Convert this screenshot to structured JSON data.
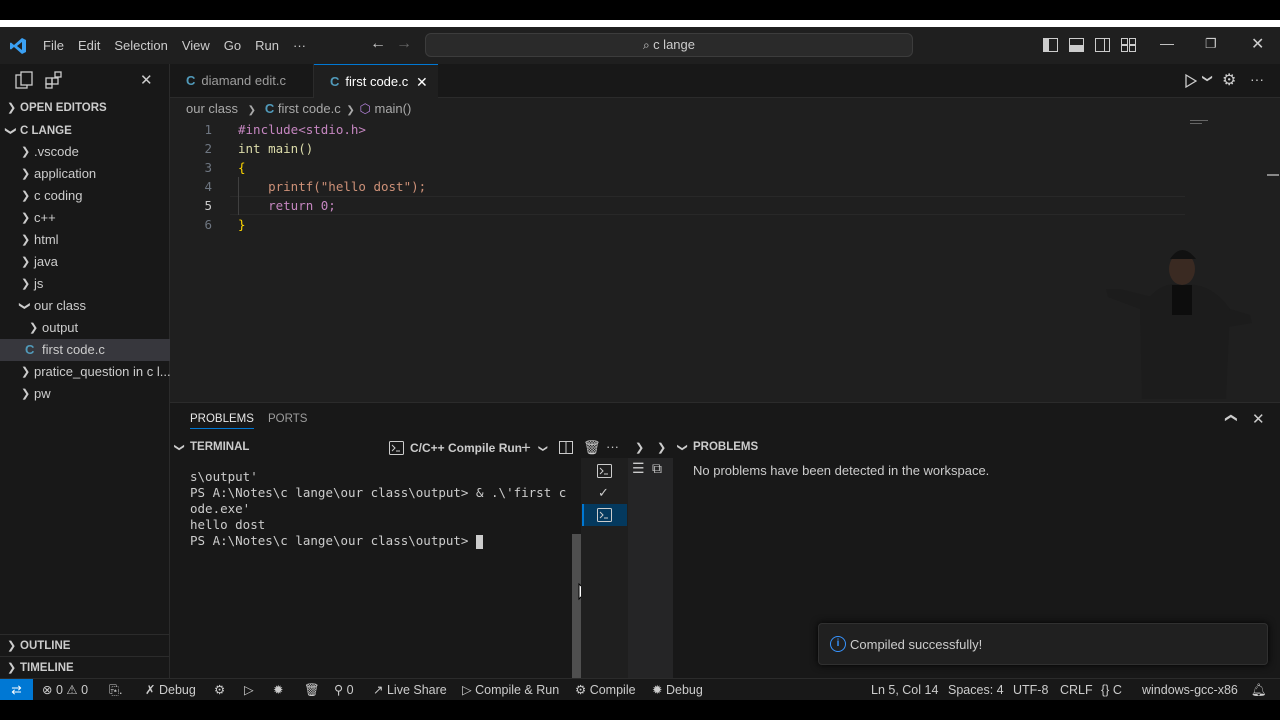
{
  "menu": {
    "file": "File",
    "edit": "Edit",
    "selection": "Selection",
    "view": "View",
    "go": "Go",
    "run": "Run",
    "more": "···"
  },
  "search": {
    "text": "c lange"
  },
  "sidebar": {
    "open_editors": "OPEN EDITORS",
    "root": "C LANGE",
    "items": [
      {
        "label": ".vscode"
      },
      {
        "label": "application"
      },
      {
        "label": "c coding"
      },
      {
        "label": "c++"
      },
      {
        "label": "html"
      },
      {
        "label": "java"
      },
      {
        "label": "js"
      },
      {
        "label": "our class"
      },
      {
        "label": "output"
      },
      {
        "label": "first code.c"
      },
      {
        "label": "pratice_question in c l..."
      },
      {
        "label": "pw"
      }
    ],
    "outline": "OUTLINE",
    "timeline": "TIMELINE"
  },
  "tabs": [
    {
      "label": "diamand edit.c"
    },
    {
      "label": "first code.c"
    }
  ],
  "breadcrumb": {
    "folder": "our class",
    "file": "first code.c",
    "symbol": "main()"
  },
  "code": {
    "line_numbers": [
      "1",
      "2",
      "3",
      "4",
      "5",
      "6"
    ],
    "lines": [
      "#include<stdio.h>",
      "int main()",
      "{",
      "    printf(\"hello dost\");",
      "    return 0;",
      "}"
    ]
  },
  "panel": {
    "tab_problems": "PROBLEMS",
    "tab_ports": "PORTS",
    "terminal_title": "TERMINAL",
    "terminal_name": "C/C++ Compile Run",
    "terminal_lines": [
      "s\\output'",
      "PS A:\\Notes\\c lange\\our class\\output> & .\\'first c",
      "ode.exe'",
      "hello dost",
      "PS A:\\Notes\\c lange\\our class\\output> "
    ],
    "problems_title": "PROBLEMS",
    "problems_msg": "No problems have been detected in the workspace."
  },
  "notification": {
    "text": "Compiled successfully!"
  },
  "status": {
    "errors": "0",
    "warnings": "0",
    "debug": "Debug",
    "ports": "0",
    "live_share": "Live Share",
    "compile_run": "Compile & Run",
    "compile": "Compile",
    "debug2": "Debug",
    "position": "Ln 5, Col 14",
    "spaces": "Spaces: 4",
    "encoding": "UTF-8",
    "eol": "CRLF",
    "lang": "C",
    "platform": "windows-gcc-x86"
  },
  "colors": {
    "accent": "#0078d4",
    "c_icon": "#519aba",
    "keyword": "#569cd6",
    "string": "#ce9178",
    "function": "#dcdcaa",
    "number": "#b5cea8",
    "brace": "#ffd700"
  }
}
